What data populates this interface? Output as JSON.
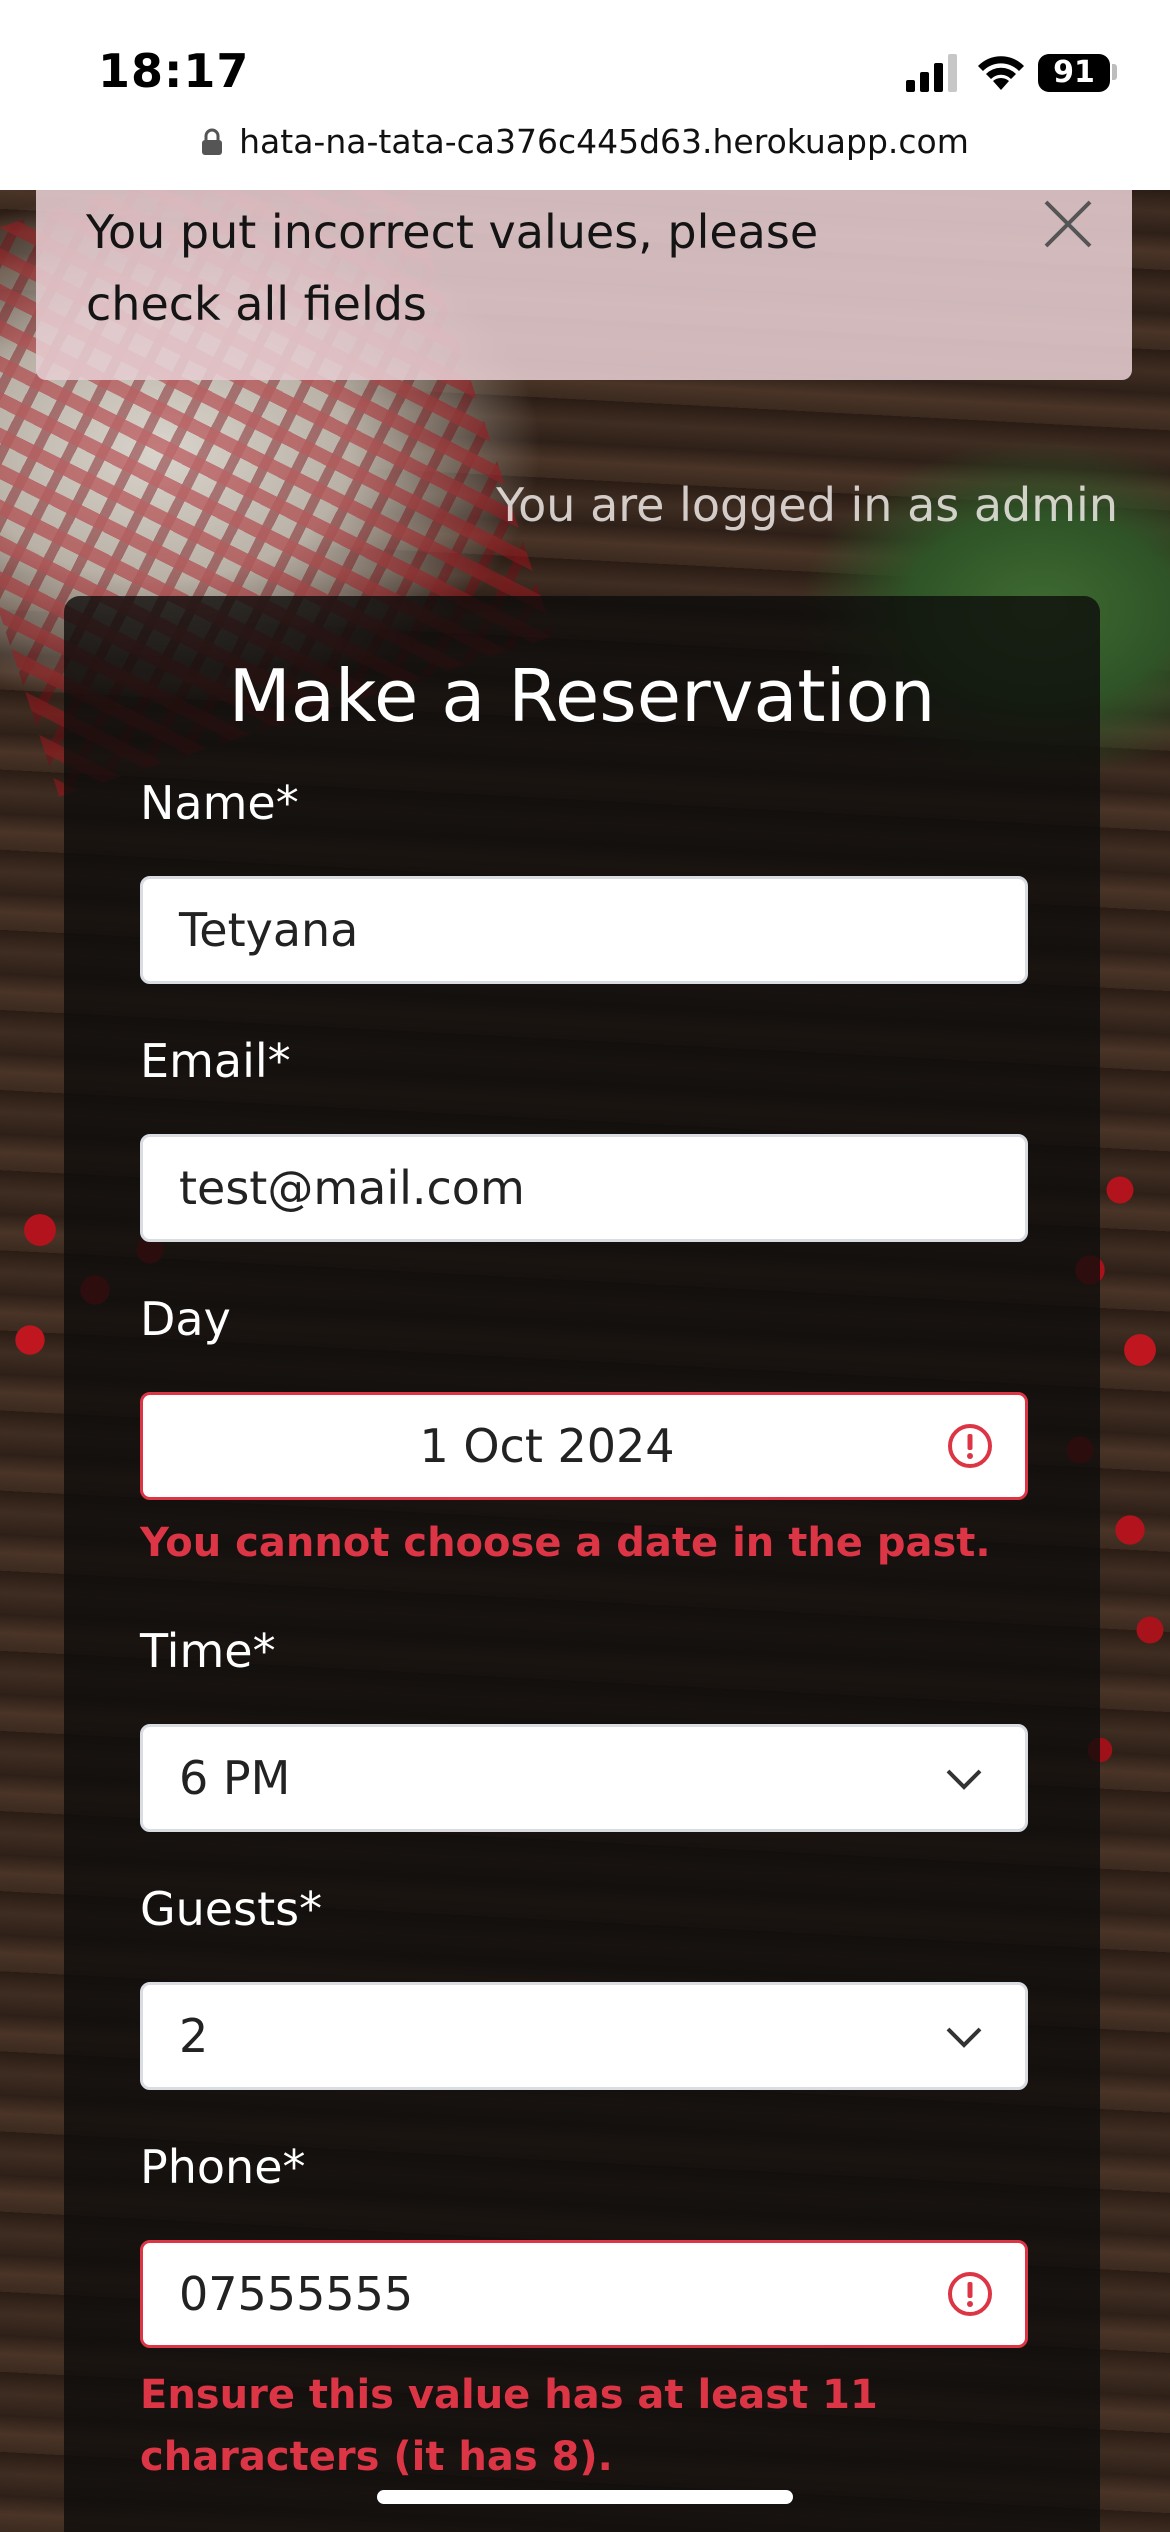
{
  "status_bar": {
    "time": "18:17",
    "battery": "91",
    "url": "hata-na-tata-ca376c445d63.herokuapp.com"
  },
  "alert": {
    "message": "You put incorrect values, please check all fields"
  },
  "login_status": "You are logged in as admin",
  "form": {
    "title": "Make a Reservation",
    "name": {
      "label": "Name*",
      "value": "Tetyana"
    },
    "email": {
      "label": "Email*",
      "value": "test@mail.com"
    },
    "day": {
      "label": "Day",
      "value": "1 Oct 2024",
      "error": "You cannot choose a date in the past."
    },
    "time": {
      "label": "Time*",
      "value": "6 PM"
    },
    "guests": {
      "label": "Guests*",
      "value": "2"
    },
    "phone": {
      "label": "Phone*",
      "value": "07555555",
      "error": "Ensure this value has at least 11 characters (it has 8)."
    }
  },
  "colors": {
    "error": "#dc3545",
    "alert_bg": "#e6cdd2",
    "panel_bg": "#0e0c0b"
  }
}
